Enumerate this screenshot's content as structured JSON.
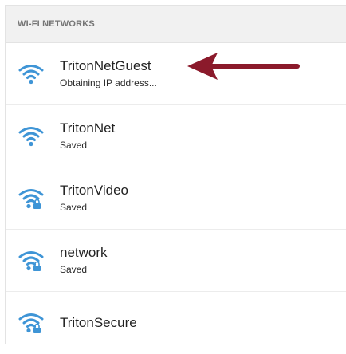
{
  "header": {
    "title": "WI-FI NETWORKS"
  },
  "networks": [
    {
      "name": "TritonNetGuest",
      "status": "Obtaining IP address...",
      "icon": "wifi-icon",
      "locked": false
    },
    {
      "name": "TritonNet",
      "status": "Saved",
      "icon": "wifi-icon",
      "locked": false
    },
    {
      "name": "TritonVideo",
      "status": "Saved",
      "icon": "wifi-lock-icon",
      "locked": true
    },
    {
      "name": "network",
      "status": "Saved",
      "icon": "wifi-lock-icon",
      "locked": true
    },
    {
      "name": "TritonSecure",
      "status": "",
      "icon": "wifi-lock-icon",
      "locked": true
    }
  ],
  "annotation": {
    "icon": "arrow-left-icon",
    "color": "#8b1a2b"
  },
  "colors": {
    "wifi": "#3f95d6",
    "header_bg": "#f1f1f1",
    "header_text": "#757575"
  }
}
